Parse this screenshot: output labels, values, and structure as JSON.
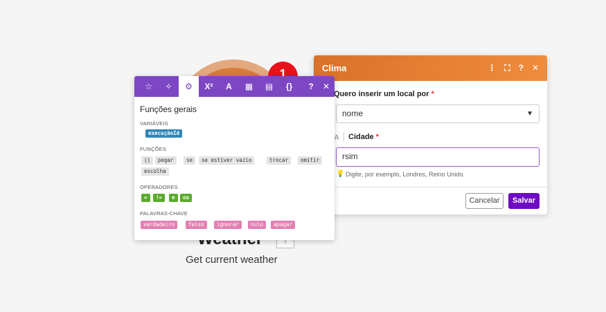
{
  "module": {
    "badge": "1",
    "title": "Weather",
    "info_label": "i",
    "subtitle": "Get current weather"
  },
  "dialog": {
    "title": "Clima",
    "icons": [
      "more-vertical-icon",
      "expand-icon",
      "help-icon",
      "close-icon"
    ],
    "icon_glyphs": {
      "more": "⋮",
      "expand": "⛶",
      "help": "?",
      "close": "✕"
    },
    "location_label": "Quero inserir um local por",
    "location_value": "nome",
    "city_type_icon": "A",
    "city_label": "Cidade",
    "city_value": "rsim",
    "hint": "Digite, por exemplo, Londres, Reino Unido.",
    "cancel_label": "Cancelar",
    "save_label": "Salvar",
    "required_mark": "*"
  },
  "panel": {
    "tabs": [
      {
        "name": "star-icon",
        "glyph": "☆"
      },
      {
        "name": "sparkle-icon",
        "glyph": "✧"
      },
      {
        "name": "gear-icon",
        "glyph": "⚙"
      },
      {
        "name": "superscript-icon",
        "glyph": "X²"
      },
      {
        "name": "text-icon",
        "glyph": "A"
      },
      {
        "name": "calendar-icon",
        "glyph": "▦"
      },
      {
        "name": "table-icon",
        "glyph": "▤"
      },
      {
        "name": "braces-icon",
        "glyph": "{}"
      }
    ],
    "help_glyph": "?",
    "close_glyph": "✕",
    "title": "Funções gerais",
    "sections": {
      "variables": "VARIÁVEIS",
      "functions": "FUNÇÕES",
      "operators": "OPERADORES",
      "keywords": "PALAVRAS-CHAVE"
    },
    "variables": [
      "execuçãoId"
    ],
    "functions": [
      "()",
      "pegar",
      "se",
      "se estiver vazio",
      "trocar",
      "omitir",
      "escolha"
    ],
    "operators": [
      "=",
      "!=",
      "e",
      "ou"
    ],
    "keywords": [
      "verdadeiro",
      "falso",
      "ignorar",
      "nulo",
      "apagar"
    ]
  },
  "colors": {
    "dialog_header": "#e07c32",
    "panel_header": "#7d47c3",
    "save_button": "#6f0bc2",
    "badge": "#e8121b",
    "variable_pill": "#2d86b8",
    "operator_pill": "#5aab2c",
    "keyword_pill": "#e27fb3"
  }
}
